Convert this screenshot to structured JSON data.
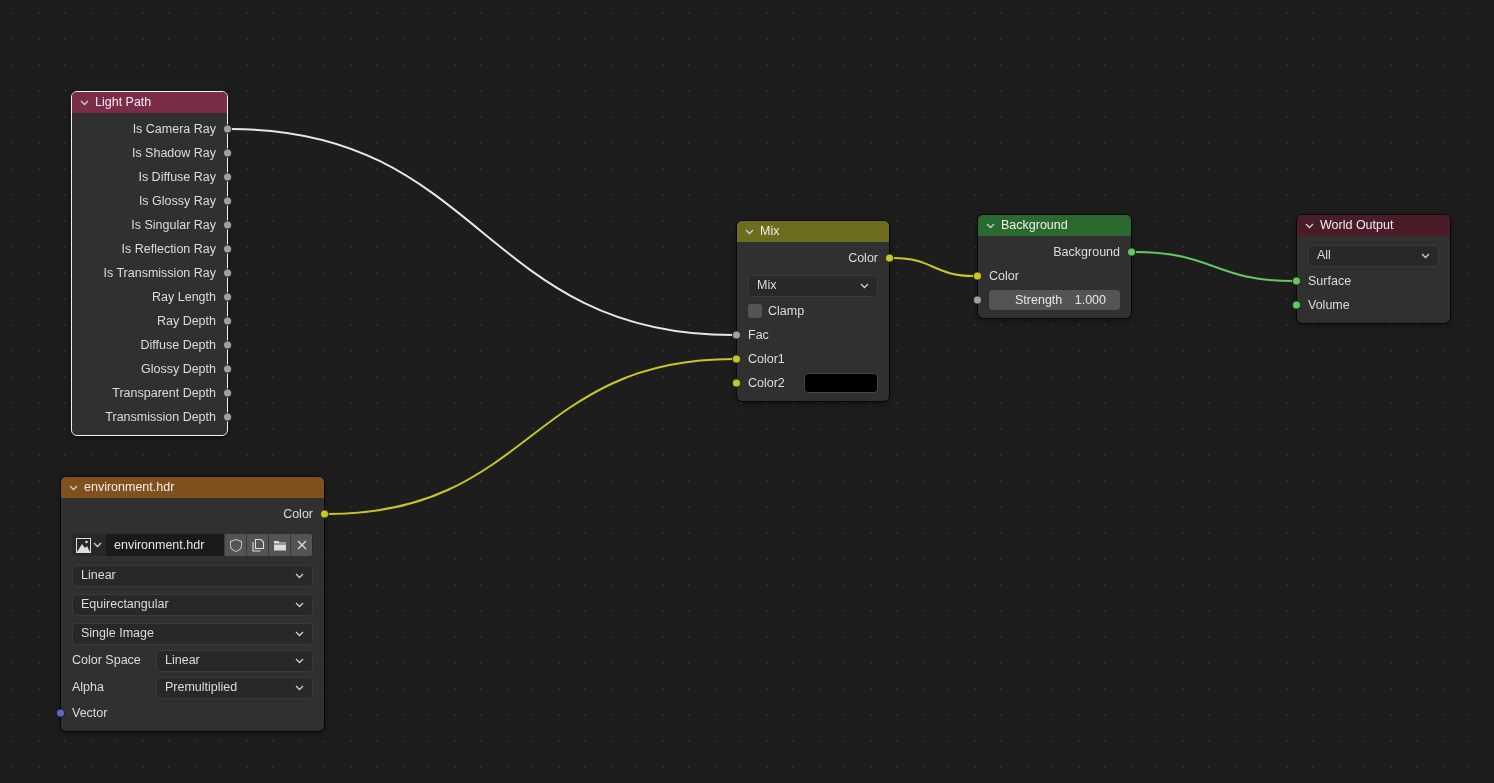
{
  "nodes": [
    {
      "title": "Light Path",
      "color": "#7b2c49",
      "selected": true,
      "expanded": true,
      "rows": [
        {
          "kind": "output",
          "label": "Is Camera Ray",
          "color": "#a1a1a1",
          "linked": true
        },
        {
          "kind": "output",
          "label": "Is Shadow Ray",
          "color": "#a1a1a1",
          "linked": false
        },
        {
          "kind": "output",
          "label": "Is Diffuse Ray",
          "color": "#a1a1a1",
          "linked": false
        },
        {
          "kind": "output",
          "label": "Is Glossy Ray",
          "color": "#a1a1a1",
          "linked": false
        },
        {
          "kind": "output",
          "label": "Is Singular Ray",
          "color": "#a1a1a1",
          "linked": false
        },
        {
          "kind": "output",
          "label": "Is Reflection Ray",
          "color": "#a1a1a1",
          "linked": false
        },
        {
          "kind": "output",
          "label": "Is Transmission Ray",
          "color": "#a1a1a1",
          "linked": false
        },
        {
          "kind": "output",
          "label": "Ray Length",
          "color": "#a1a1a1",
          "linked": false
        },
        {
          "kind": "output",
          "label": "Ray Depth",
          "color": "#a1a1a1",
          "linked": false
        },
        {
          "kind": "output",
          "label": "Diffuse Depth",
          "color": "#a1a1a1",
          "linked": false
        },
        {
          "kind": "output",
          "label": "Glossy Depth",
          "color": "#a1a1a1",
          "linked": false
        },
        {
          "kind": "output",
          "label": "Transparent Depth",
          "color": "#a1a1a1",
          "linked": false
        },
        {
          "kind": "output",
          "label": "Transmission Depth",
          "color": "#a1a1a1",
          "linked": false
        }
      ]
    },
    {
      "title": "environment.hdr",
      "color": "#81501f",
      "selected": false,
      "expanded": true,
      "rows": [
        {
          "kind": "output",
          "label": "Color",
          "color": "#c7c729",
          "linked": true
        },
        {
          "kind": "image",
          "value": "environment.hdr"
        },
        {
          "kind": "select",
          "value": "Linear"
        },
        {
          "kind": "select",
          "value": "Equirectangular"
        },
        {
          "kind": "select",
          "value": "Single Image"
        },
        {
          "kind": "labeled_select",
          "label": "Color Space",
          "value": "Linear"
        },
        {
          "kind": "labeled_select",
          "label": "Alpha",
          "value": "Premultiplied"
        },
        {
          "kind": "input",
          "label": "Vector",
          "color": "#6363c7",
          "linked": false
        }
      ]
    },
    {
      "title": "Mix",
      "color": "#6e6c1d",
      "selected": false,
      "expanded": true,
      "rows": [
        {
          "kind": "output",
          "label": "Color",
          "color": "#c7c729",
          "linked": true
        },
        {
          "kind": "select",
          "value": "Mix"
        },
        {
          "kind": "checkbox",
          "label": "Clamp",
          "checked": false
        },
        {
          "kind": "input",
          "label": "Fac",
          "color": "#a1a1a1",
          "linked": true
        },
        {
          "kind": "input",
          "label": "Color1",
          "color": "#c7c729",
          "linked": true
        },
        {
          "kind": "color_input",
          "label": "Color2",
          "color": "#c7c729",
          "linked": false,
          "swatch": {
            "color": "#000000"
          }
        }
      ]
    },
    {
      "title": "Background",
      "color": "#2a6a2e",
      "selected": false,
      "expanded": true,
      "rows": [
        {
          "kind": "output",
          "label": "Background",
          "color": "#63c763",
          "linked": true
        },
        {
          "kind": "input",
          "label": "Color",
          "color": "#c7c729",
          "linked": true
        },
        {
          "kind": "value",
          "label": "Strength",
          "value": "1.000",
          "color": "#a1a1a1",
          "linked": false
        }
      ]
    },
    {
      "title": "World Output",
      "color": "#4a1c27",
      "selected": false,
      "expanded": true,
      "rows": [
        {
          "kind": "select",
          "value": "All"
        },
        {
          "kind": "input",
          "label": "Surface",
          "color": "#63c763",
          "linked": true
        },
        {
          "kind": "input",
          "label": "Volume",
          "color": "#63c763",
          "linked": false
        }
      ]
    }
  ],
  "links": [
    {
      "color": "#e6e6e6"
    },
    {
      "color": "#c7c729"
    },
    {
      "color": "#c7c729"
    },
    {
      "color": "#63c763"
    }
  ]
}
